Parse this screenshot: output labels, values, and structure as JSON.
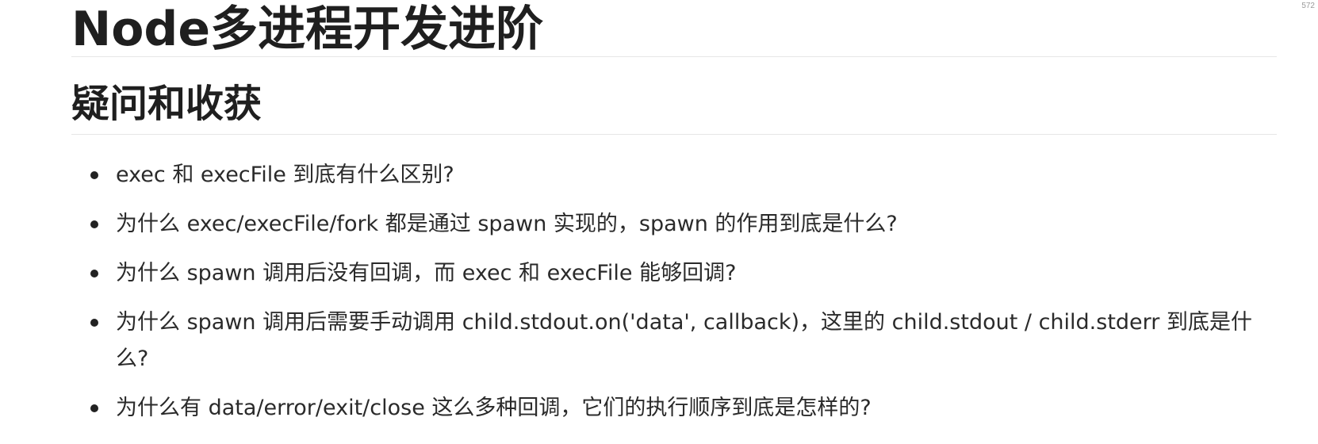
{
  "corner_marker": "572",
  "heading1": "Node多进程开发进阶",
  "heading2": "疑问和收获",
  "items": [
    {
      "text": "exec 和 execFile 到底有什么区别?"
    },
    {
      "text": "为什么 exec/execFile/fork 都是通过 spawn 实现的，spawn 的作用到底是什么?"
    },
    {
      "text": "为什么 spawn 调用后没有回调，而 exec 和 execFile 能够回调?"
    },
    {
      "text": "为什么 spawn 调用后需要手动调用 child.stdout.on('data', callback)，这里的 child.stdout / child.stderr 到底是什么?"
    },
    {
      "text": "为什么有 data/error/exit/close 这么多种回调，它们的执行顺序到底是怎样的?"
    }
  ]
}
